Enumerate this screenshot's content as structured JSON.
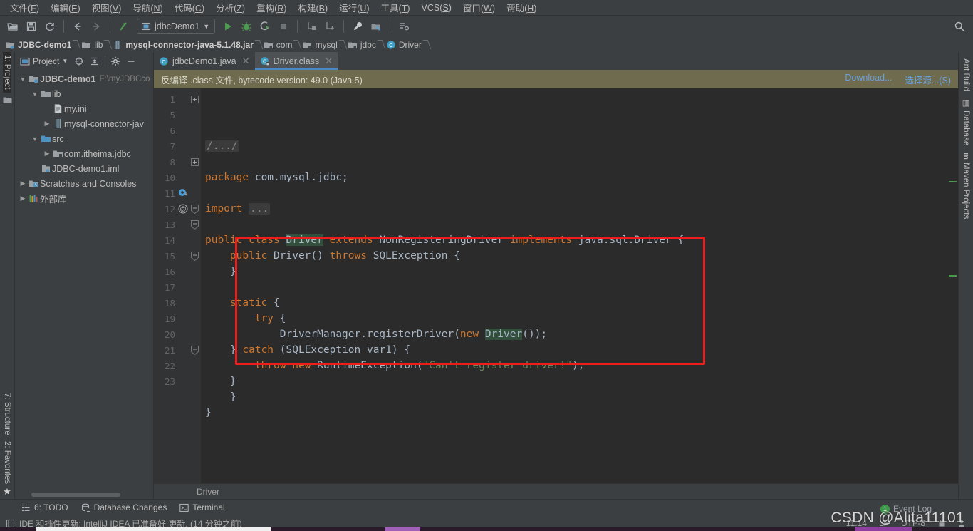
{
  "menubar": [
    {
      "label": "文件(F)"
    },
    {
      "label": "编辑(E)"
    },
    {
      "label": "视图(V)"
    },
    {
      "label": "导航(N)"
    },
    {
      "label": "代码(C)"
    },
    {
      "label": "分析(Z)"
    },
    {
      "label": "重构(R)"
    },
    {
      "label": "构建(B)"
    },
    {
      "label": "运行(U)"
    },
    {
      "label": "工具(T)"
    },
    {
      "label": "VCS(S)"
    },
    {
      "label": "窗口(W)"
    },
    {
      "label": "帮助(H)"
    }
  ],
  "toolbar": {
    "run_configuration": "jdbcDemo1",
    "icons": [
      "open-folder-icon",
      "save-icon",
      "sync-icon",
      "back-arrow-icon",
      "forward-arrow-icon",
      "update-project-icon",
      "run-icon",
      "debug-icon",
      "run-with-coverage-icon",
      "stop-icon",
      "build-module-icon",
      "build-artifacts-icon",
      "settings-wrench-icon",
      "project-structure-icon",
      "sdk-manager-icon",
      "search-everywhere-icon"
    ]
  },
  "breadcrumb": [
    {
      "label": "JDBC-demo1",
      "icon": "module-icon",
      "bold": true
    },
    {
      "label": "lib",
      "icon": "folder-icon",
      "bold": false
    },
    {
      "label": "mysql-connector-java-5.1.48.jar",
      "icon": "jar-icon",
      "bold": true
    },
    {
      "label": "com",
      "icon": "package-icon",
      "bold": false
    },
    {
      "label": "mysql",
      "icon": "package-icon",
      "bold": false
    },
    {
      "label": "jdbc",
      "icon": "package-icon",
      "bold": false
    },
    {
      "label": "Driver",
      "icon": "class-icon",
      "bold": false
    }
  ],
  "left_stripe": {
    "top": [
      {
        "label": "1: Project",
        "active": true
      }
    ],
    "bottom": [
      {
        "label": "7: Structure"
      },
      {
        "label": "2: Favorites"
      }
    ]
  },
  "right_stripe": [
    {
      "label": "Ant Build",
      "active": false
    },
    {
      "label": "Database",
      "active": false
    },
    {
      "label": "Maven Projects",
      "active": false
    }
  ],
  "project_panel": {
    "title": "Project",
    "tree": [
      {
        "indent": 0,
        "twist": "▼",
        "icon": "module-icon",
        "label": "JDBC-demo1",
        "bold": true,
        "sub": "F:\\myJDBCco"
      },
      {
        "indent": 1,
        "twist": "▼",
        "icon": "folder-icon",
        "label": "lib",
        "bold": false,
        "sub": ""
      },
      {
        "indent": 2,
        "twist": "",
        "icon": "file-ini-icon",
        "label": "my.ini",
        "bold": false,
        "sub": ""
      },
      {
        "indent": 2,
        "twist": "▶",
        "icon": "jar-icon",
        "label": "mysql-connector-jav",
        "bold": false,
        "sub": ""
      },
      {
        "indent": 1,
        "twist": "▼",
        "icon": "source-folder-icon",
        "label": "src",
        "bold": false,
        "sub": ""
      },
      {
        "indent": 2,
        "twist": "▶",
        "icon": "package-icon",
        "label": "com.itheima.jdbc",
        "bold": false,
        "sub": ""
      },
      {
        "indent": 1,
        "twist": "",
        "icon": "iml-icon",
        "label": "JDBC-demo1.iml",
        "bold": false,
        "sub": ""
      },
      {
        "indent": 0,
        "twist": "▶",
        "icon": "scratches-icon",
        "label": "Scratches and Consoles",
        "bold": false,
        "sub": ""
      },
      {
        "indent": 0,
        "twist": "▶",
        "icon": "library-icon",
        "label": "外部库",
        "bold": false,
        "sub": ""
      }
    ]
  },
  "editor": {
    "tabs": [
      {
        "label": "jdbcDemo1.java",
        "icon": "java-class-icon",
        "active": false,
        "close": "✕"
      },
      {
        "label": "Driver.class",
        "icon": "decompiled-class-icon",
        "active": true,
        "close": "✕"
      }
    ],
    "notice": {
      "text": "反编译 .class 文件, bytecode version: 49.0 (Java 5)",
      "download_label": "Download...",
      "choose_sources_label": "选择源...(S)"
    },
    "line_numbers": [
      "1",
      "5",
      "6",
      "7",
      "8",
      "10",
      "11",
      "12",
      "13",
      "14",
      "15",
      "16",
      "17",
      "18",
      "19",
      "20",
      "21",
      "22",
      "23"
    ],
    "lines": [
      {
        "n": "1",
        "fold": "+",
        "segments": [
          {
            "t": "/.../",
            "c": "fold"
          }
        ]
      },
      {
        "n": "5",
        "fold": "",
        "segments": []
      },
      {
        "n": "6",
        "fold": "",
        "segments": [
          {
            "t": "package ",
            "c": "kw"
          },
          {
            "t": "com.mysql.jdbc;",
            "c": "id"
          }
        ]
      },
      {
        "n": "7",
        "fold": "",
        "segments": []
      },
      {
        "n": "8",
        "fold": "+",
        "segments": [
          {
            "t": "import ",
            "c": "kw"
          },
          {
            "t": "...",
            "c": "fold"
          }
        ]
      },
      {
        "n": "10",
        "fold": "",
        "segments": []
      },
      {
        "n": "11",
        "fold": "",
        "segments": [
          {
            "t": "public ",
            "c": "kw"
          },
          {
            "t": "class ",
            "c": "kw"
          },
          {
            "t": "Driver",
            "c": "hl"
          },
          {
            "t": " extends ",
            "c": "kw"
          },
          {
            "t": "NonRegisteringDriver",
            "c": "id"
          },
          {
            "t": " implements ",
            "c": "kw"
          },
          {
            "t": "java.sql.Driver {",
            "c": "id"
          }
        ]
      },
      {
        "n": "12",
        "fold": "-",
        "segments": [
          {
            "t": "    public ",
            "c": "kw"
          },
          {
            "t": "Driver() ",
            "c": "id"
          },
          {
            "t": "throws ",
            "c": "kw"
          },
          {
            "t": "SQLException {",
            "c": "id"
          }
        ]
      },
      {
        "n": "13",
        "fold": "-",
        "segments": [
          {
            "t": "    }",
            "c": "id"
          }
        ]
      },
      {
        "n": "14",
        "fold": "",
        "segments": []
      },
      {
        "n": "15",
        "fold": "-",
        "segments": [
          {
            "t": "    static ",
            "c": "kw"
          },
          {
            "t": "{",
            "c": "id"
          }
        ]
      },
      {
        "n": "16",
        "fold": "",
        "segments": [
          {
            "t": "        try ",
            "c": "kw"
          },
          {
            "t": "{",
            "c": "id"
          }
        ]
      },
      {
        "n": "17",
        "fold": "",
        "segments": [
          {
            "t": "            DriverManager.registerDriver(",
            "c": "id"
          },
          {
            "t": "new ",
            "c": "kw"
          },
          {
            "t": "Driver",
            "c": "hl"
          },
          {
            "t": "());",
            "c": "id"
          }
        ]
      },
      {
        "n": "18",
        "fold": "",
        "segments": [
          {
            "t": "    } ",
            "c": "id"
          },
          {
            "t": "catch ",
            "c": "kw"
          },
          {
            "t": "(SQLException var1) {",
            "c": "id"
          }
        ]
      },
      {
        "n": "19",
        "fold": "",
        "segments": [
          {
            "t": "        throw new ",
            "c": "kw"
          },
          {
            "t": "RuntimeException(",
            "c": "id"
          },
          {
            "t": "\"Can't register driver!\"",
            "c": "str"
          },
          {
            "t": ");",
            "c": "id"
          }
        ]
      },
      {
        "n": "20",
        "fold": "",
        "segments": [
          {
            "t": "    }",
            "c": "id"
          }
        ]
      },
      {
        "n": "21",
        "fold": "-",
        "segments": [
          {
            "t": "    }",
            "c": "id"
          }
        ]
      },
      {
        "n": "22",
        "fold": "",
        "segments": [
          {
            "t": "}",
            "c": "id"
          }
        ]
      },
      {
        "n": "23",
        "fold": "",
        "segments": []
      }
    ],
    "annotations": [
      {
        "line": "11",
        "glyph": "implemented-method-icon"
      },
      {
        "line": "12",
        "glyph": "@"
      }
    ],
    "highlight_box": {
      "color": "#ee1c1c"
    },
    "footer_breadcrumb": "Driver"
  },
  "bottom_toolwindows": [
    {
      "label": "6: TODO",
      "icon": "todo-icon"
    },
    {
      "label": "Database Changes",
      "icon": "database-changes-icon"
    },
    {
      "label": "Terminal",
      "icon": "terminal-icon"
    }
  ],
  "statusbar": {
    "message": "IDE 和插件更新: IntelliJ IDEA 已准备好 更新. (14 分钟之前)",
    "caret_position": "11:14",
    "line_separator": "LF",
    "encoding": "UTF-8",
    "event_log_label": "Event Log",
    "event_log_count": "1"
  },
  "watermark": "CSDN @Alita11101",
  "colors": {
    "accent_blue": "#4a88c7",
    "notice_bg": "#6e6b4e",
    "highlight_red": "#ee1c1c",
    "editor_bg": "#2b2b2b",
    "chrome_bg": "#3c3f41"
  }
}
